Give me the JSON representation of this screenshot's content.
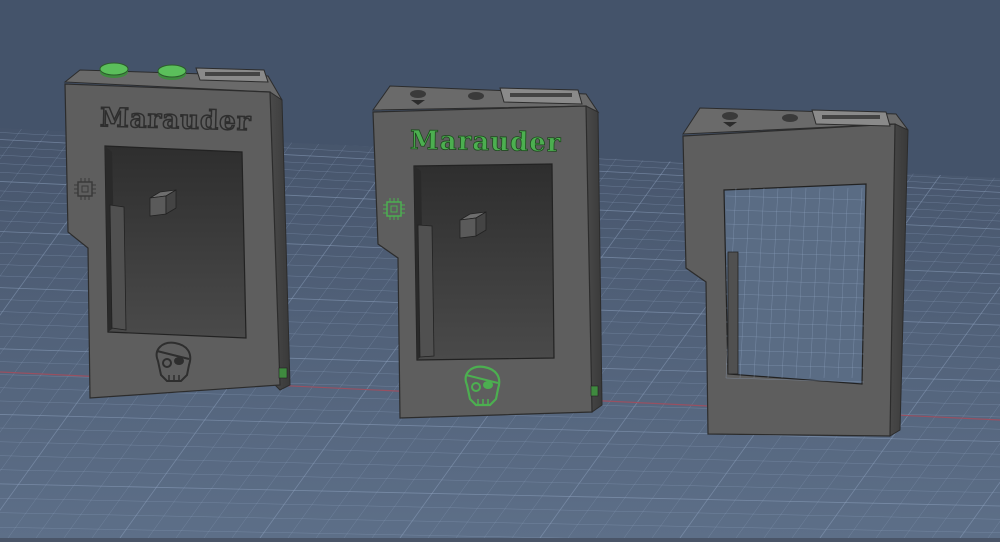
{
  "scene": {
    "background_top": "#3f4c62",
    "background_bottom": "#5a6c84",
    "grid_color": "#8fa3c0",
    "red_axis_color": "#b0505f",
    "body_color": "#5f5f5f",
    "body_dark": "#4a4a4a",
    "body_edge": "#2c2c2c",
    "cavity_color": "#3d3d3d",
    "accent_green": "#4caf50"
  },
  "models": [
    {
      "name": "Marauder",
      "logo_color": "#3a3a3a",
      "style": "engraved",
      "buttons": "green"
    },
    {
      "name": "Marauder",
      "logo_color": "#4caf50",
      "style": "green-inlay",
      "buttons": "gray"
    },
    {
      "name": "",
      "logo_color": "",
      "style": "frame-only",
      "buttons": "gray"
    }
  ]
}
